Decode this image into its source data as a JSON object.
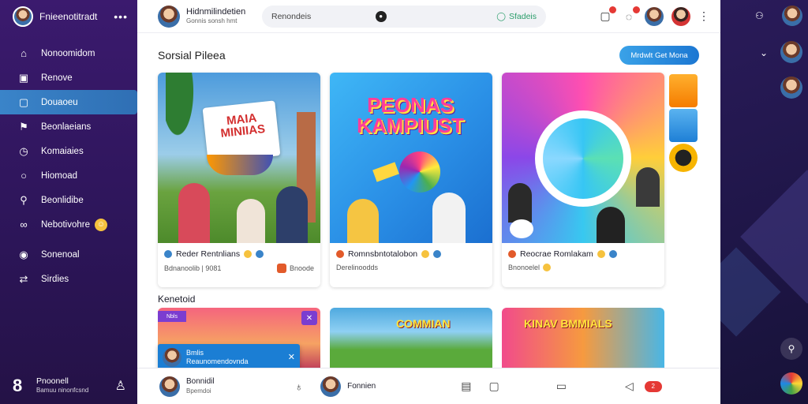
{
  "sidebar": {
    "app_name": "Fnieenotitradt",
    "items": [
      {
        "label": "Nonoomidom",
        "icon": "home-icon"
      },
      {
        "label": "Renove",
        "icon": "tv-icon"
      },
      {
        "label": "Douaoeu",
        "icon": "chat-icon",
        "active": true
      },
      {
        "label": "Beonlaeians",
        "icon": "flag-icon"
      },
      {
        "label": "Komaiaies",
        "icon": "clock-icon"
      },
      {
        "label": "Hiomoad",
        "icon": "circle-icon"
      },
      {
        "label": "Beonlidibe",
        "icon": "pin-icon"
      },
      {
        "label": "Nebotivohre",
        "icon": "link-icon"
      },
      {
        "label": "Sonenoal",
        "icon": "user-circle-icon"
      },
      {
        "label": "Sirdies",
        "icon": "share-icon"
      }
    ],
    "footer": {
      "title": "Pnoonell",
      "subtitle": "Bamuu ninonfcsnd"
    }
  },
  "topbar": {
    "title": "Hidnmilindetien",
    "subtitle": "Gonnis sonsh hmt",
    "search_placeholder": "Renondeis",
    "search_right": "Sfadeis"
  },
  "main": {
    "section_title": "Sorsial Pileea",
    "cta_label": "Mrdwlt Get Mona",
    "cards": [
      {
        "title": "Reder Rentnlians",
        "meta": "Bdnanoolib | 9081",
        "end_label": "Bnoode",
        "headline": "MAIA MINIIAS"
      },
      {
        "title": "Romnsbntotalobon",
        "meta": "Derelinoodds",
        "end_label": "",
        "headline": "PEONAS KAMPIUST"
      },
      {
        "title": "Reocrae Romlakam",
        "meta": "Bnonoelel",
        "end_label": "",
        "headline": ""
      }
    ],
    "section2_title": "Kenetoid",
    "thumbs": [
      {
        "headline": "",
        "tag": "Nbls"
      },
      {
        "headline": "COMMIAN"
      },
      {
        "headline": "KINAV  BMMIALS"
      }
    ],
    "toast": {
      "title": "Bmlis",
      "subtitle": "Reaunomendovnda"
    }
  },
  "bottombar": {
    "user_name": "Bonnidil",
    "user_sub": "Bpemdoi",
    "center_name": "Fonnien",
    "badge_label": "2"
  },
  "colors": {
    "sidebar_bg": "#2c1558",
    "active_item": "#3a84c9",
    "accent": "#1c77d2",
    "notification": "#e53935"
  }
}
